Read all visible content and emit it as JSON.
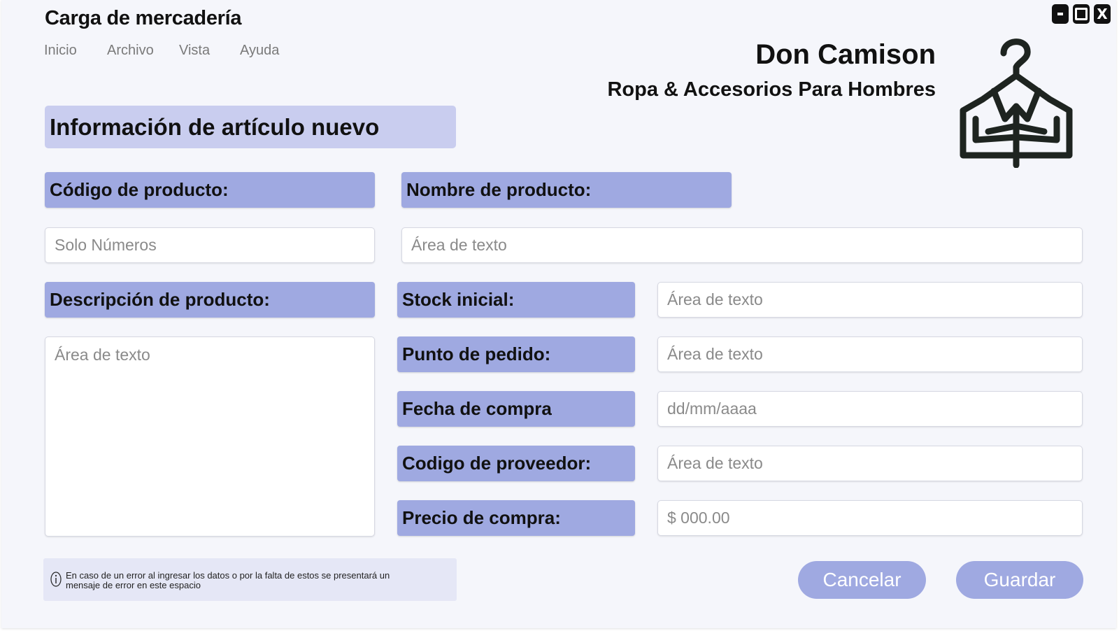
{
  "window": {
    "title": "Carga de mercadería",
    "controls": [
      "minimize-icon",
      "maximize-icon",
      "close-icon"
    ],
    "close_label": "X"
  },
  "menu": {
    "items": [
      {
        "label": "Inicio"
      },
      {
        "label": "Archivo"
      },
      {
        "label": "Vista"
      },
      {
        "label": "Ayuda"
      }
    ]
  },
  "brand": {
    "name": "Don Camison",
    "tagline": "Ropa & Accesorios Para Hombres",
    "logo_icon": "shirt-hanger-icon"
  },
  "form": {
    "section_title": "Información de artículo nuevo",
    "codigo": {
      "label": "Código de producto:",
      "placeholder": "Solo Números"
    },
    "nombre": {
      "label": "Nombre de producto:",
      "placeholder": "Área de texto"
    },
    "descripcion": {
      "label": "Descripción de producto:",
      "placeholder": "Área de texto"
    },
    "stock": {
      "label": "Stock inicial:",
      "placeholder": "Área de texto"
    },
    "punto_pedido": {
      "label": "Punto de pedido:",
      "placeholder": "Área de texto"
    },
    "fecha": {
      "label": "Fecha de compra",
      "placeholder": "dd/mm/aaaa"
    },
    "proveedor": {
      "label": "Codigo de proveedor:",
      "placeholder": "Área de texto"
    },
    "precio": {
      "label": "Precio de compra:",
      "placeholder": "$ 000.00"
    }
  },
  "error_area": {
    "icon": "info-icon",
    "message": "En caso de un error al ingresar los datos o por la falta de estos se presentará un mensaje de error en este espacio"
  },
  "actions": {
    "cancel_label": "Cancelar",
    "save_label": "Guardar"
  },
  "colors": {
    "label_bg": "#9fa9e1",
    "section_bg": "#c9cdef",
    "window_bg": "#f5f6fb",
    "error_bg": "#e5e7f6"
  }
}
